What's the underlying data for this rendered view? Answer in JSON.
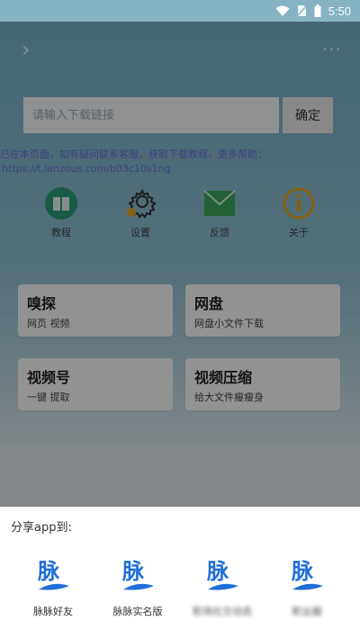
{
  "status_bar": {
    "time": "5:50"
  },
  "app": {
    "search": {
      "placeholder": "请输入下载链接",
      "confirm_label": "确定"
    },
    "notice": {
      "line1": "已在本页面，如有疑问联系客服，获取下载教程，更多帮助：",
      "line2": "https://t.lanzous.com/b03c10s1ng"
    },
    "icons": [
      {
        "name": "book-icon",
        "label": "教程"
      },
      {
        "name": "gear-icon",
        "label": "设置"
      },
      {
        "name": "mail-icon",
        "label": "反馈"
      },
      {
        "name": "info-icon",
        "label": "关于"
      }
    ],
    "cards": [
      {
        "title": "嗅探",
        "subtitle": "网页 视频"
      },
      {
        "title": "网盘",
        "subtitle": "网盘小文件下载"
      },
      {
        "title": "视频号",
        "subtitle": "一键 提取"
      },
      {
        "title": "视频压缩",
        "subtitle": "给大文件瘦瘦身"
      }
    ]
  },
  "share_sheet": {
    "title": "分享app到:",
    "items": [
      {
        "name": "脉脉好友",
        "logo_char": "脉",
        "blurred": false
      },
      {
        "name": "脉脉实名版",
        "logo_char": "脉",
        "blurred": false
      },
      {
        "name": "职场社交动态",
        "logo_char": "脉",
        "blurred": true
      },
      {
        "name": "职业圈",
        "logo_char": "脉",
        "blurred": true
      }
    ]
  },
  "colors": {
    "brand_blue": "#1f6fd6",
    "accent_green": "#2a9e7a",
    "notice": "#6b6fd6"
  }
}
